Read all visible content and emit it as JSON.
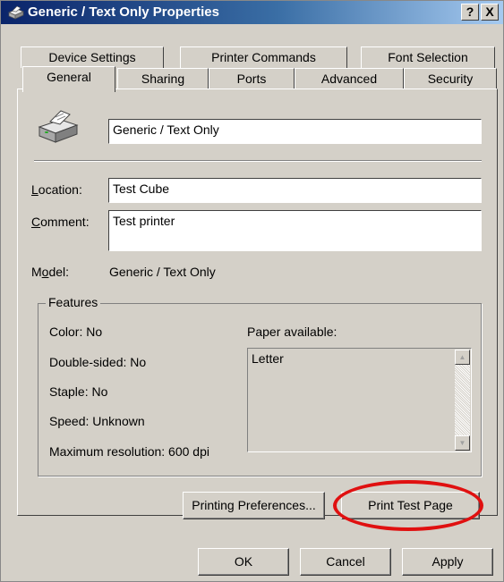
{
  "window": {
    "title": "Generic / Text Only Properties"
  },
  "titlebar": {
    "help_label": "?",
    "close_label": "X"
  },
  "tabs_top": [
    "Device Settings",
    "Printer Commands",
    "Font Selection"
  ],
  "tabs_bottom": [
    "General",
    "Sharing",
    "Ports",
    "Advanced",
    "Security"
  ],
  "active_tab": "General",
  "general": {
    "printer_name": "Generic / Text Only",
    "location_label": "Location:",
    "location_value": "Test Cube",
    "comment_label": "Comment:",
    "comment_value": "Test printer",
    "model_label": "Model:",
    "model_value": "Generic / Text Only"
  },
  "features": {
    "title": "Features",
    "color": "Color: No",
    "double_sided": "Double-sided: No",
    "staple": "Staple: No",
    "speed": "Speed: Unknown",
    "max_resolution": "Maximum resolution: 600 dpi",
    "paper_label": "Paper available:",
    "paper_items": [
      "Letter"
    ]
  },
  "buttons": {
    "printing_preferences": "Printing Preferences...",
    "print_test_page": "Print Test Page",
    "ok": "OK",
    "cancel": "Cancel",
    "apply": "Apply"
  },
  "annotation": {
    "ellipse_color": "#e01010",
    "target": "print-test-page-button"
  },
  "colors": {
    "dialog_bg": "#d4d0c8",
    "title_start": "#0a246a",
    "title_end": "#a6caf0"
  },
  "icons": [
    "printer-icon",
    "help-icon",
    "close-icon",
    "scroll-up-icon",
    "scroll-down-icon"
  ]
}
